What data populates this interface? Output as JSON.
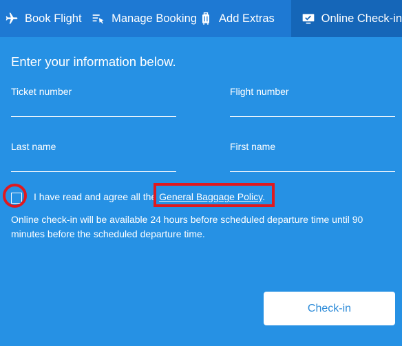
{
  "tabs": [
    {
      "label": "Book Flight",
      "icon": "airplane-icon"
    },
    {
      "label": "Manage Booking",
      "icon": "manage-list-icon"
    },
    {
      "label": "Add Extras",
      "icon": "luggage-icon"
    },
    {
      "label": "Online Check-in",
      "icon": "checkin-screen-icon",
      "active": true
    }
  ],
  "form": {
    "intro": "Enter your information below.",
    "ticket_label": "Ticket number",
    "flight_label": "Flight number",
    "last_label": "Last name",
    "first_label": "First name"
  },
  "agreement": {
    "text_before": "I have read and agree all the ",
    "link_text": "General Baggage Policy",
    "text_after": ".",
    "checked": false
  },
  "note": "Online check-in will be available 24 hours before scheduled departure time until 90 minutes before the scheduled departure time.",
  "submit_label": "Check-in",
  "colors": {
    "page_bg": "#2691e4",
    "tabbar_bg": "#1e79d3",
    "active_tab_bg": "#1566b8",
    "highlight": "#e0191f",
    "button_text": "#2b8ad8"
  }
}
